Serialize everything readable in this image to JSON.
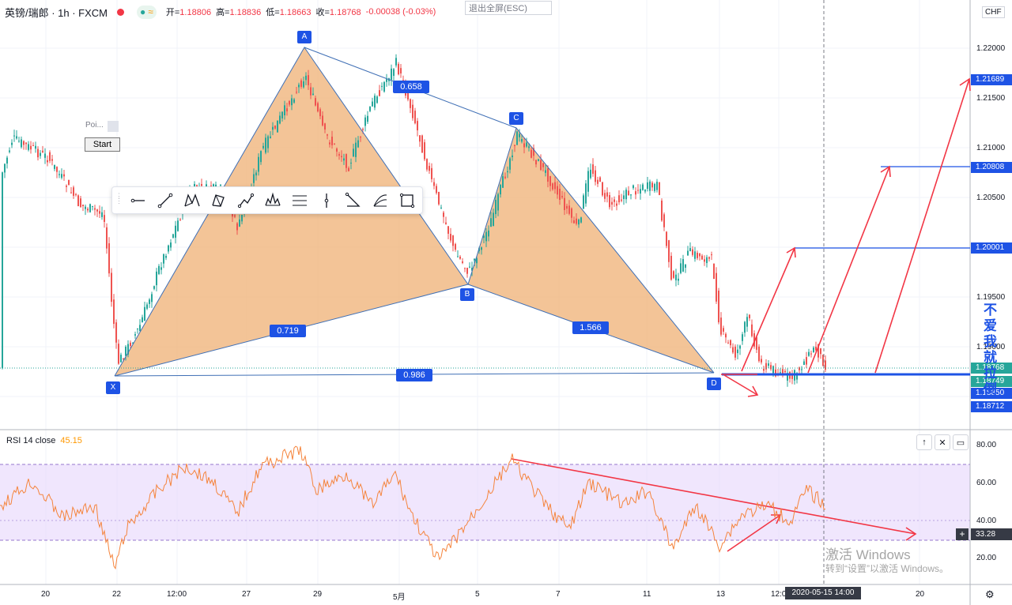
{
  "header": {
    "symbol": "英镑/瑞郎 · 1h · FXCM",
    "open_label": "开=",
    "open": "1.18806",
    "high_label": "高=",
    "high": "1.18836",
    "low_label": "低=",
    "low": "1.18663",
    "close_label": "收=",
    "close": "1.18768",
    "change": "-0.00038 (-0.03%)",
    "status_dot_color": "#f23645"
  },
  "exit_fullscreen": "退出全屏(ESC)",
  "point_tool": {
    "label": "Poi..."
  },
  "start_button": "Start",
  "drawing_toolbar": {
    "icons": [
      "line-tool-icon",
      "trend-line-icon",
      "xabcd-pattern-icon",
      "cypher-pattern-icon",
      "abcd-pattern-icon",
      "head-shoulders-icon",
      "fib-retracement-icon",
      "vertical-line-icon",
      "triangle-pattern-icon",
      "fib-fan-icon",
      "rectangle-icon"
    ]
  },
  "currency": "CHF",
  "price_axis": [
    "1.22000",
    "1.21500",
    "1.21000",
    "1.20500",
    "1.19500",
    "1.19000"
  ],
  "price_tags": [
    {
      "text": "1.21689",
      "color": "#1e53e5"
    },
    {
      "text": "1.20808",
      "color": "#1e53e5"
    },
    {
      "text": "1.20001",
      "color": "#1e53e5"
    },
    {
      "text": "1.18712",
      "color": "#1e53e5"
    },
    {
      "text": "1.18749",
      "color": "#26a69a"
    },
    {
      "text": "1.18768",
      "color": "#26a69a"
    },
    {
      "text": "1.18850",
      "color": "#1e53e5"
    }
  ],
  "pattern": {
    "points": [
      "X",
      "A",
      "B",
      "C",
      "D"
    ],
    "ratios": {
      "xb": "0.719",
      "ac": "0.658",
      "bd": "1.566",
      "xd": "0.986"
    },
    "fill_color": "#f0b57d",
    "line_color": "#3f6fb5"
  },
  "vertical_text": "不爱我就拉倒",
  "rsi": {
    "label": "RSI 14 close",
    "value": "45.15",
    "axis": [
      "80.00",
      "60.00",
      "40.00",
      "20.00"
    ],
    "crosshair_value": "33.28",
    "line_color": "#f5843c",
    "band_color": "#e6d5fb"
  },
  "pane_buttons": {
    "up": "↑",
    "close": "✕",
    "maximize": "▭"
  },
  "time_axis": [
    "20",
    "22",
    "12:00",
    "27",
    "29",
    "5月",
    "5",
    "7",
    "11",
    "13",
    "12:00",
    "20"
  ],
  "crosshair_time": "2020-05-15 14:00",
  "windows_watermark": {
    "line1": "激活 Windows",
    "line2": "转到“设置”以激活 Windows。"
  },
  "colors": {
    "up": "#26a69a",
    "down": "#ef5350",
    "annotation_red": "#f23645",
    "target_blue": "#1e53e5"
  }
}
